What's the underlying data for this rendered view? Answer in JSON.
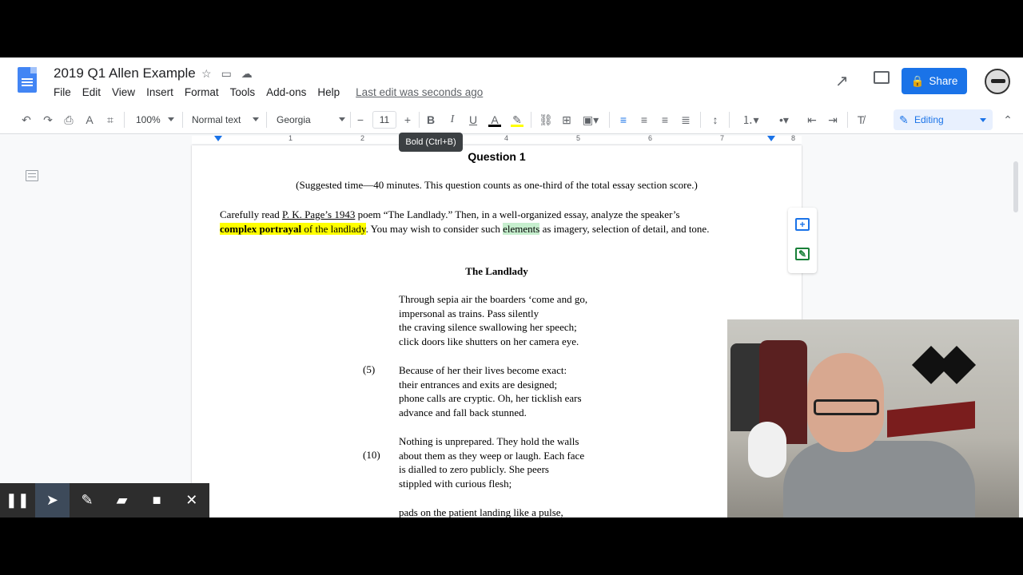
{
  "app": {
    "doc_title": "2019 Q1 Allen Example",
    "last_edit": "Last edit was seconds ago",
    "share_label": "Share"
  },
  "menu": [
    "File",
    "Edit",
    "View",
    "Insert",
    "Format",
    "Tools",
    "Add-ons",
    "Help"
  ],
  "toolbar": {
    "zoom": "100%",
    "style": "Normal text",
    "font": "Georgia",
    "font_size": "11",
    "tooltip": "Bold (Ctrl+B)",
    "mode": "Editing"
  },
  "ruler_numbers": [
    "1",
    "2",
    "3",
    "4",
    "5",
    "6",
    "7",
    "8"
  ],
  "document": {
    "question_title": "Question 1",
    "suggestion": "(Suggested time—40 minutes. This question counts as one-third of the total essay section score.)",
    "prompt": {
      "p1": "Carefully read ",
      "p2": "P. K. Page’s 1943",
      "p3": " poem “The Landlady.” Then, in a well-organized essay, analyze the speaker’s",
      "p4": "complex portrayal",
      "p5": " of the landlady",
      "p6": ". You may wish to consider such ",
      "p7": "elements",
      "p8": " as imagery, selection of detail, and tone."
    },
    "poem_title": "The Landlady",
    "stanzas": [
      [
        "Through sepia air the boarders ‘come and go,",
        "impersonal as trains. Pass silently",
        "the craving silence swallowing her speech;",
        "click doors like shutters on her camera eye."
      ],
      [
        "Because of her their lives become exact:",
        "their entrances and exits are designed;",
        "phone calls are cryptic. Oh, her ticklish ears",
        "advance and fall back stunned."
      ],
      [
        "Nothing is unprepared. They hold the walls",
        "about them as they weep or laugh. Each face",
        "is dialled to zero publicly. She peers",
        "stippled with curious flesh;"
      ],
      [
        "pads on the patient landing like a pulse,"
      ]
    ],
    "line_numbers": [
      "(5)",
      "(10)"
    ]
  },
  "colors": {
    "share": "#1a73e8",
    "highlight_yellow": "#ffff00",
    "highlight_green": "#c6efce"
  }
}
